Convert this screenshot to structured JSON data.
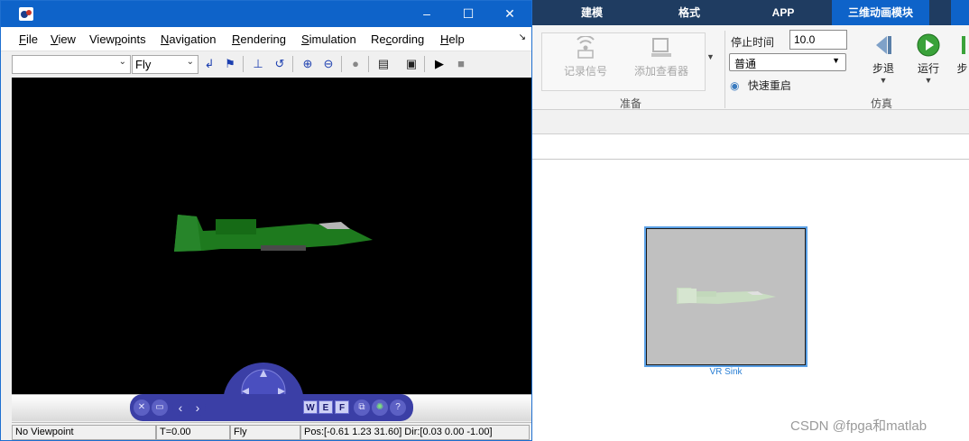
{
  "simulink": {
    "tabs": [
      {
        "label": "建模",
        "active": false
      },
      {
        "label": "格式",
        "active": false
      },
      {
        "label": "APP",
        "active": false
      },
      {
        "label": "三维动画模块",
        "active": true
      }
    ],
    "prepare_group": {
      "label": "准备",
      "log_signals_label": "记录信号",
      "add_viewer_label": "添加查看器"
    },
    "simulate_group": {
      "label": "仿真",
      "stop_time_label": "停止时间",
      "stop_time_value": "10.0",
      "mode_value": "普通",
      "fast_restart_label": "快速重启",
      "step_back_label": "步退",
      "run_label": "运行",
      "step_forward_label": "步"
    },
    "block": {
      "label": "VR Sink"
    },
    "watermark": "CSDN @fpga和matlab"
  },
  "vr_viewer": {
    "window_controls": {
      "minimize": "–",
      "maximize": "☐",
      "close": "✕"
    },
    "menu": {
      "file": {
        "accel": "F",
        "rest": "ile"
      },
      "view": {
        "accel": "V",
        "rest": "iew"
      },
      "viewpoints": {
        "pre": "View",
        "accel": "p",
        "rest": "oints"
      },
      "navigation": {
        "accel": "N",
        "rest": "avigation"
      },
      "rendering": {
        "accel": "R",
        "rest": "endering"
      },
      "simulation": {
        "accel": "S",
        "rest": "imulation"
      },
      "recording": {
        "pre": "Re",
        "accel": "c",
        "rest": "ording"
      },
      "help": {
        "accel": "H",
        "rest": "elp"
      },
      "overflow": "↘"
    },
    "toolbar": {
      "viewpoint_select_value": "",
      "nav_mode_select_value": "Fly"
    },
    "navpanel_keys": [
      "W",
      "E",
      "F"
    ],
    "status": {
      "viewpoint": "No Viewpoint",
      "time": "T=0.00",
      "nav_mode": "Fly",
      "position": "Pos:[-0.61 1.23 31.60] Dir:[0.03 0.00 -1.00]"
    },
    "colors": {
      "titlebar": "#0e63c9",
      "viewport_bg": "#000000",
      "aircraft": "#1e7a1e",
      "navpanel": "#3b3fa6"
    }
  }
}
